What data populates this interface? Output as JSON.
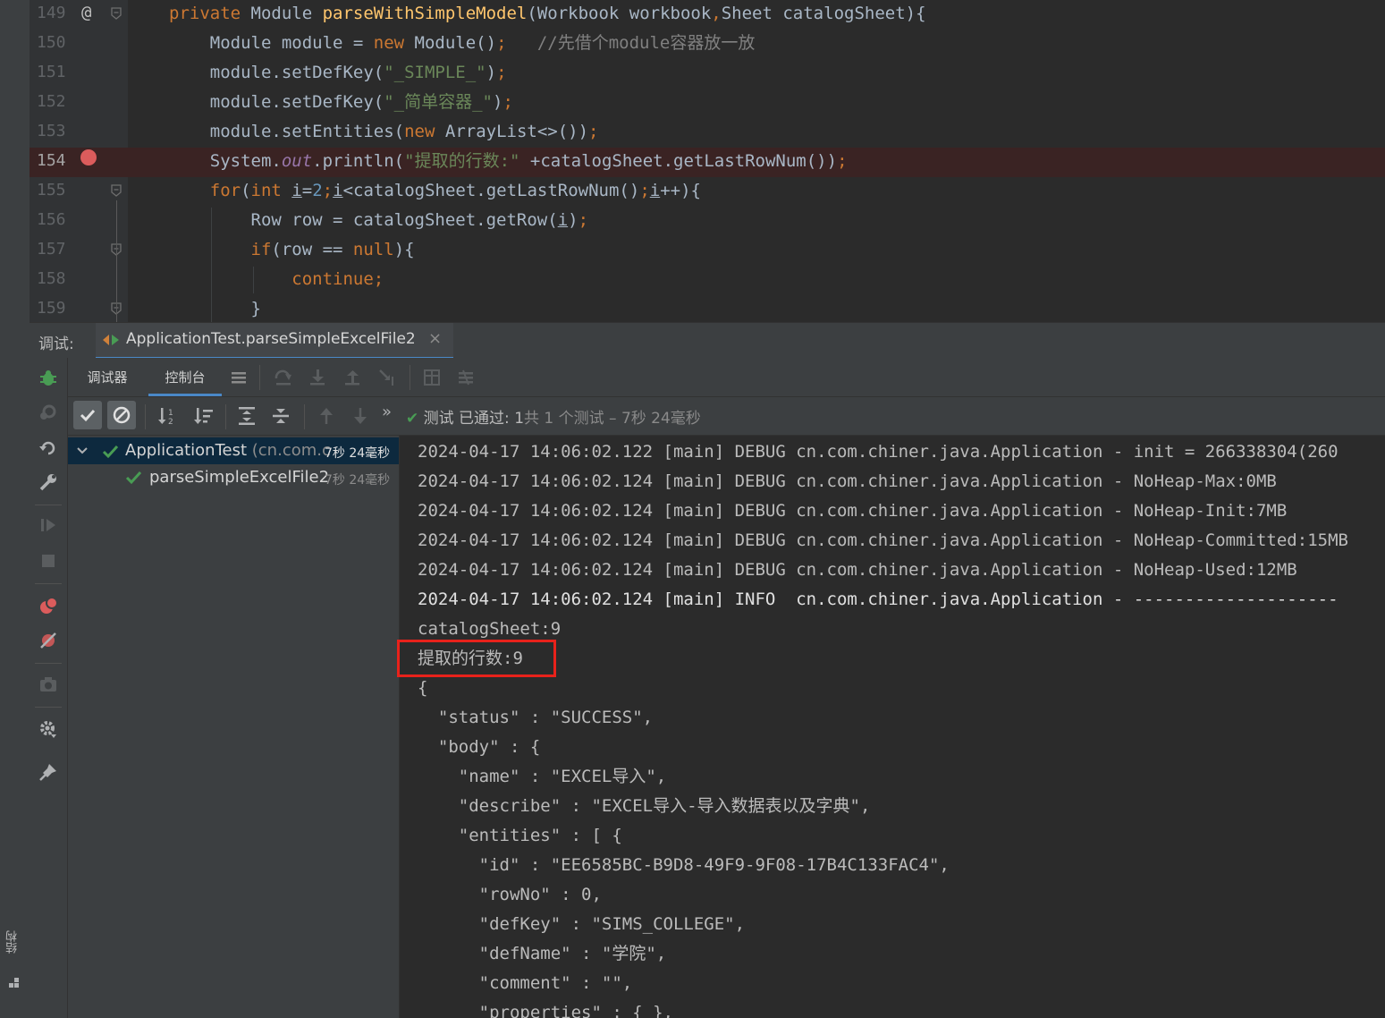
{
  "editor": {
    "lines": [
      {
        "num": "149",
        "tokens": [
          {
            "t": "private ",
            "c": "kw"
          },
          {
            "t": "Module ",
            "c": ""
          },
          {
            "t": "parseWithSimpleModel",
            "c": "fn"
          },
          {
            "t": "(Workbook workbook",
            "c": ""
          },
          {
            "t": ",",
            "c": "kw"
          },
          {
            "t": "Sheet catalogSheet){",
            "c": ""
          }
        ]
      },
      {
        "num": "150",
        "tokens": [
          {
            "t": "    Module module = ",
            "c": ""
          },
          {
            "t": "new ",
            "c": "kw"
          },
          {
            "t": "Module()",
            "c": ""
          },
          {
            "t": ";",
            "c": "kw"
          },
          {
            "t": "   //先借个module容器放一放",
            "c": "cmt"
          }
        ]
      },
      {
        "num": "151",
        "tokens": [
          {
            "t": "    module.setDefKey(",
            "c": ""
          },
          {
            "t": "\"_SIMPLE_\"",
            "c": "str"
          },
          {
            "t": ")",
            "c": ""
          },
          {
            "t": ";",
            "c": "kw"
          }
        ]
      },
      {
        "num": "152",
        "tokens": [
          {
            "t": "    module.setDefKey(",
            "c": ""
          },
          {
            "t": "\"_简单容器_\"",
            "c": "str"
          },
          {
            "t": ")",
            "c": ""
          },
          {
            "t": ";",
            "c": "kw"
          }
        ]
      },
      {
        "num": "153",
        "tokens": [
          {
            "t": "    module.setEntities(",
            "c": ""
          },
          {
            "t": "new ",
            "c": "kw"
          },
          {
            "t": "ArrayList<>())",
            "c": ""
          },
          {
            "t": ";",
            "c": "kw"
          }
        ]
      },
      {
        "num": "154",
        "tokens": [
          {
            "t": "    System.",
            "c": ""
          },
          {
            "t": "out",
            "c": "fld"
          },
          {
            "t": ".println(",
            "c": ""
          },
          {
            "t": "\"提取的行数:\" ",
            "c": "str"
          },
          {
            "t": "+catalogSheet.getLastRowNum())",
            "c": ""
          },
          {
            "t": ";",
            "c": "kw"
          }
        ]
      },
      {
        "num": "155",
        "tokens": [
          {
            "t": "    ",
            "c": ""
          },
          {
            "t": "for",
            "c": "kw"
          },
          {
            "t": "(",
            "c": ""
          },
          {
            "t": "int ",
            "c": "kw"
          },
          {
            "t": "i",
            "c": "ul"
          },
          {
            "t": "=",
            "c": ""
          },
          {
            "t": "2",
            "c": "num"
          },
          {
            "t": ";",
            "c": "kw"
          },
          {
            "t": "i",
            "c": "ul"
          },
          {
            "t": "<catalogSheet.getLastRowNum()",
            "c": ""
          },
          {
            "t": ";",
            "c": "kw"
          },
          {
            "t": "i",
            "c": "ul"
          },
          {
            "t": "++){",
            "c": ""
          }
        ]
      },
      {
        "num": "156",
        "tokens": [
          {
            "t": "        Row row = catalogSheet.getRow(",
            "c": ""
          },
          {
            "t": "i",
            "c": "ul"
          },
          {
            "t": ")",
            "c": ""
          },
          {
            "t": ";",
            "c": "kw"
          }
        ]
      },
      {
        "num": "157",
        "tokens": [
          {
            "t": "        ",
            "c": ""
          },
          {
            "t": "if",
            "c": "kw"
          },
          {
            "t": "(row == ",
            "c": ""
          },
          {
            "t": "null",
            "c": "kw"
          },
          {
            "t": "){",
            "c": ""
          }
        ]
      },
      {
        "num": "158",
        "tokens": [
          {
            "t": "            ",
            "c": ""
          },
          {
            "t": "continue",
            "c": "kw"
          },
          {
            "t": ";",
            "c": "kw"
          }
        ]
      },
      {
        "num": "159",
        "tokens": [
          {
            "t": "        }",
            "c": ""
          }
        ]
      }
    ],
    "breakpoint_line": "154",
    "override_marker": "@"
  },
  "debug_panel": {
    "label": "调试:",
    "run_tab_title": "ApplicationTest.parseSimpleExcelFile2",
    "close_glyph": "×",
    "tabs": {
      "debugger": "调试器",
      "console": "控制台"
    },
    "more_glyph": "»",
    "status": {
      "check": "✔",
      "passed": "测试 已通过: 1",
      "total": "共 1 个测试 – 7秒 24毫秒"
    }
  },
  "test_tree": {
    "class_row": {
      "name": "ApplicationTest",
      "package": "(cn.com.c",
      "time": "7秒 24毫秒"
    },
    "method_row": {
      "name": "parseSimpleExcelFile2",
      "time": "7秒 24毫秒"
    }
  },
  "console": {
    "lines": [
      "2024-04-17 14:06:02.122 [main] DEBUG cn.com.chiner.java.Application - init = 266338304(260",
      "2024-04-17 14:06:02.124 [main] DEBUG cn.com.chiner.java.Application - NoHeap-Max:0MB",
      "2024-04-17 14:06:02.124 [main] DEBUG cn.com.chiner.java.Application - NoHeap-Init:7MB",
      "2024-04-17 14:06:02.124 [main] DEBUG cn.com.chiner.java.Application - NoHeap-Committed:15MB",
      "2024-04-17 14:06:02.124 [main] DEBUG cn.com.chiner.java.Application - NoHeap-Used:12MB",
      "2024-04-17 14:06:02.124 [main] INFO  cn.com.chiner.java.Application - --------------------",
      "catalogSheet:9",
      "提取的行数:9",
      "{",
      "  \"status\" : \"SUCCESS\",",
      "  \"body\" : {",
      "    \"name\" : \"EXCEL导入\",",
      "    \"describe\" : \"EXCEL导入-导入数据表以及字典\",",
      "    \"entities\" : [ {",
      "      \"id\" : \"EE6585BC-B9D8-49F9-9F08-17B4C133FAC4\",",
      "      \"rowNo\" : 0,",
      "      \"defKey\" : \"SIMS_COLLEGE\",",
      "      \"defName\" : \"学院\",",
      "      \"comment\" : \"\",",
      "      \"properties\" : { },"
    ]
  },
  "structure_label": "结构",
  "colors": {
    "accent": "#4a88c7",
    "breakpoint": "#db5c5c",
    "pass_green": "#499c54",
    "highlight": "#e8221b"
  }
}
